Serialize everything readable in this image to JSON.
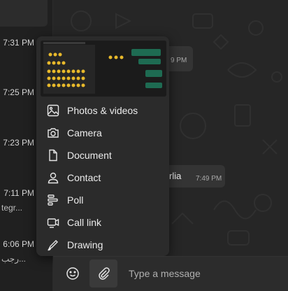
{
  "chat_list": {
    "times": [
      "7:31 PM",
      "7:25 PM",
      "7:23 PM",
      "7:11 PM",
      "6:06 PM"
    ],
    "previews": [
      "tegr...",
      "رجب..."
    ]
  },
  "chat": {
    "bubble_1_time": "9 PM",
    "bubble_2_text": "rlia",
    "bubble_2_time": "7:49 PM"
  },
  "attach_menu": {
    "items": [
      {
        "label": "Photos & videos",
        "icon": "image-icon"
      },
      {
        "label": "Camera",
        "icon": "camera-icon"
      },
      {
        "label": "Document",
        "icon": "document-icon"
      },
      {
        "label": "Contact",
        "icon": "person-icon"
      },
      {
        "label": "Poll",
        "icon": "poll-icon"
      },
      {
        "label": "Call link",
        "icon": "call-link-icon"
      },
      {
        "label": "Drawing",
        "icon": "pen-icon"
      }
    ]
  },
  "composer": {
    "placeholder": "Type a message",
    "emoji_icon": "smiley-icon",
    "attach_icon": "paperclip-icon"
  },
  "colors": {
    "background": "#1f1f1f",
    "menu": "#2b2b2b",
    "composer": "#2c2c2c",
    "accent_green": "#1e6b52"
  }
}
